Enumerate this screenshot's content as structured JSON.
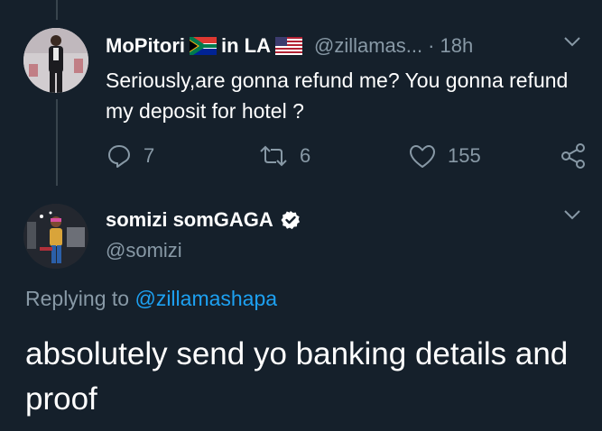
{
  "tweet": {
    "author_name": "MoPitori",
    "location_text": "in LA",
    "handle": "@zillamas...",
    "separator": "·",
    "time": "18h",
    "text": "Seriously,are gonna refund me? You gonna refund my deposit for hotel ?",
    "flags": [
      "south-africa-flag",
      "us-flag"
    ],
    "actions": {
      "replies": "7",
      "retweets": "6",
      "likes": "155"
    }
  },
  "reply": {
    "author_name": "somizi somGAGA",
    "handle": "@somizi",
    "verified": true,
    "replying_to_label": "Replying to",
    "replying_to_handle": "@zillamashapa",
    "text": "absolutely send yo banking details and proof"
  },
  "colors": {
    "background": "#15202b",
    "muted": "#8899a6",
    "accent": "#1da1f2",
    "text": "#ffffff"
  },
  "icons": [
    "chevron-down-icon",
    "reply-icon",
    "retweet-icon",
    "heart-icon",
    "share-icon",
    "verified-badge-icon"
  ]
}
